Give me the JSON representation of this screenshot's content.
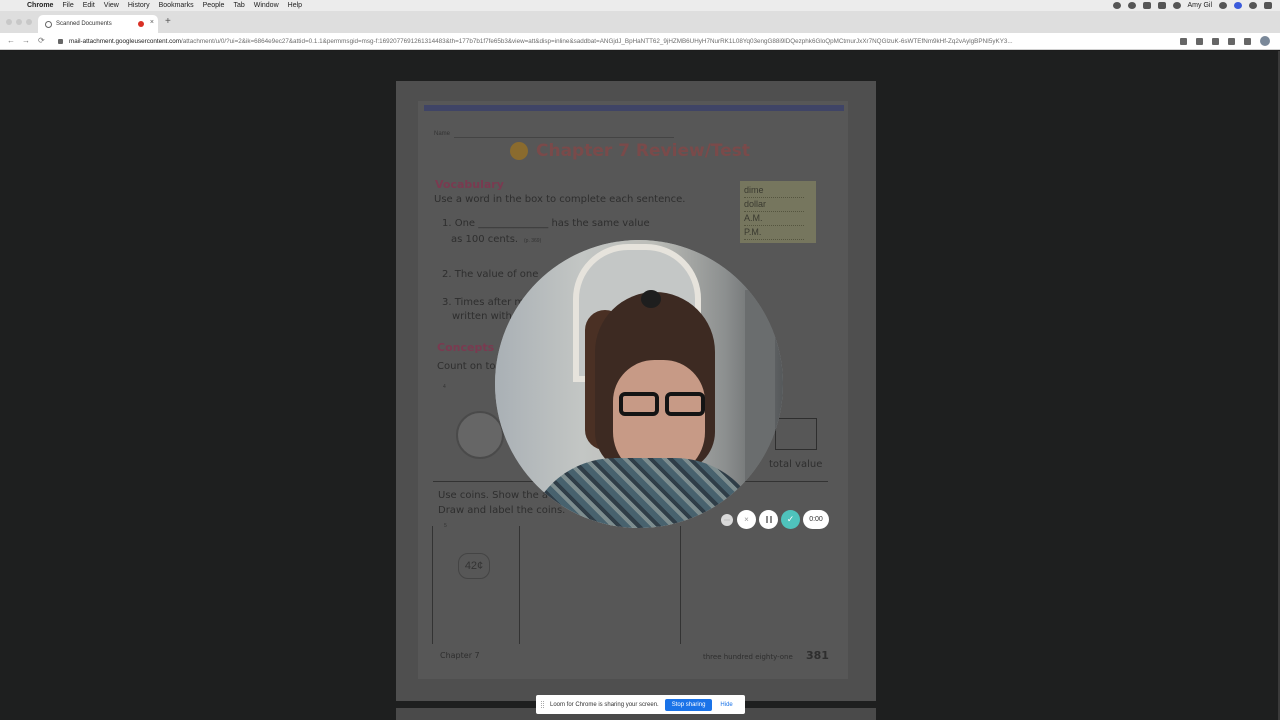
{
  "menubar": {
    "app": "Chrome",
    "items": [
      "File",
      "Edit",
      "View",
      "History",
      "Bookmarks",
      "People",
      "Tab",
      "Window",
      "Help"
    ],
    "user": "Amy Gil"
  },
  "tab": {
    "title": "Scanned Documents",
    "close": "×",
    "new_tab": "+"
  },
  "address": {
    "host": "mail-attachment.googleusercontent.com",
    "path": "/attachment/u/0/?ui=2&ik=6864e9ec27&attid=0.1.1&permmsgid=msg-f:1692077691261314483&th=177b7b1f7fe65b3&view=att&disp=inline&saddbat=ANGjdJ_BpHaNTT62_9jHZMB6UHyH7NurRK1L08Yq03engG88i9lDQezphk6GloQpMCtmurJxXr7NQGlzuK-6sWTEfNm9kHf-Zq2vAylgBPNI5yKY3...",
    "back": "←",
    "forward": "→",
    "reload": "⟳"
  },
  "document": {
    "name_label": "Name",
    "title": "Chapter 7 Review/Test",
    "vocabulary": "Vocabulary",
    "instruction": "Use a word in the box to complete each sentence.",
    "q1a": "1.  One ______________ has the same value",
    "q1b": "as 100 cents.",
    "q1ref": "(p. 369)",
    "q2": "2.  The value of one",
    "q3a": "3.  Times after m",
    "q3b": "written with",
    "concepts": "Concepts",
    "count_on": "Count on to",
    "q4": "4",
    "word_box": [
      "dime",
      "dollar",
      "A.M.",
      "P.M."
    ],
    "total_value": "total value",
    "use_coins": "Use coins. Show the a",
    "draw_label": "Draw and label the coins.",
    "q5": "5",
    "price": "42¢",
    "footer_left": "Chapter 7",
    "footer_right": "three hundred eighty-one",
    "page_number": "381"
  },
  "recording": {
    "timer": "0:00",
    "cancel": "×",
    "done": "✓",
    "more": "⋯"
  },
  "share_bar": {
    "message": "Loom for Chrome is sharing your screen.",
    "stop": "Stop sharing",
    "hide": "Hide"
  },
  "colors": {
    "stop_button": "#1a73e8",
    "done_button": "#4fc3bc",
    "recording_dot": "#d93025"
  }
}
